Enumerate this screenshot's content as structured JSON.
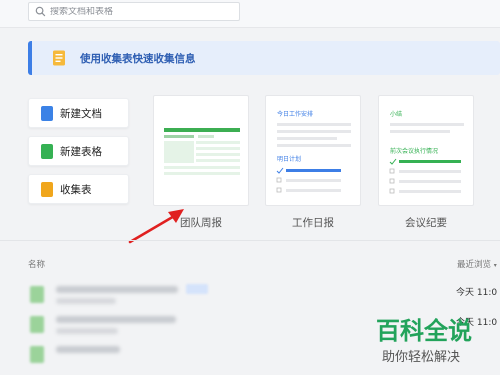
{
  "search": {
    "placeholder": "搜索文档和表格"
  },
  "banner": {
    "text": "使用收集表快速收集信息"
  },
  "create": [
    {
      "label": "新建文档",
      "color": "#3b82e6"
    },
    {
      "label": "新建表格",
      "color": "#35b153"
    },
    {
      "label": "收集表",
      "color": "#f0a61c"
    }
  ],
  "templates": [
    {
      "label": "团队周报"
    },
    {
      "label": "工作日报",
      "heading": "今日工作安排",
      "subheading": "明日计划"
    },
    {
      "label": "会议纪要",
      "heading": "小结",
      "subheading": "前次会议执行情况"
    }
  ],
  "list": {
    "col_name": "名称",
    "col_recent": "最近浏览",
    "rows": [
      {
        "time": "今天 11:0"
      },
      {
        "time": "今天 11:0"
      },
      {
        "time": ""
      }
    ]
  },
  "watermark": {
    "big": "百科全说",
    "small": "助你轻松解决"
  },
  "colors": {
    "accent": "#3d7ee6",
    "green": "#35b153",
    "arrow": "#e02020"
  }
}
